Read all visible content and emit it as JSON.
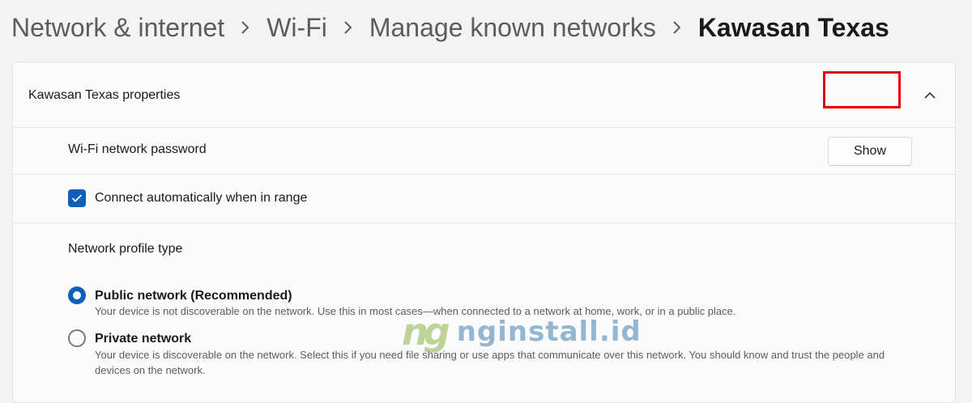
{
  "breadcrumb": {
    "items": [
      "Network & internet",
      "Wi-Fi",
      "Manage known networks"
    ],
    "current": "Kawasan Texas",
    "separator_icon": "chevron-right-icon"
  },
  "properties": {
    "title": "Kawasan Texas properties",
    "collapse_icon": "chevron-up-icon",
    "password": {
      "label": "Wi-Fi network password",
      "button_label": "Show"
    },
    "auto_connect": {
      "label": "Connect automatically when in range",
      "checked": true
    },
    "profile": {
      "heading": "Network profile type",
      "options": [
        {
          "title": "Public network (Recommended)",
          "description": "Your device is not discoverable on the network. Use this in most cases—when connected to a network at home, work, or in a public place.",
          "selected": true
        },
        {
          "title": "Private network",
          "description": "Your device is discoverable on the network. Select this if you need file sharing or use apps that communicate over this network. You should know and trust the people and devices on the network.",
          "selected": false
        }
      ]
    }
  },
  "annotation": {
    "highlight_color": "#e30000",
    "accent_color": "#0d5fb8"
  },
  "watermark": {
    "mark": "ng",
    "text": "nginstall.id"
  }
}
